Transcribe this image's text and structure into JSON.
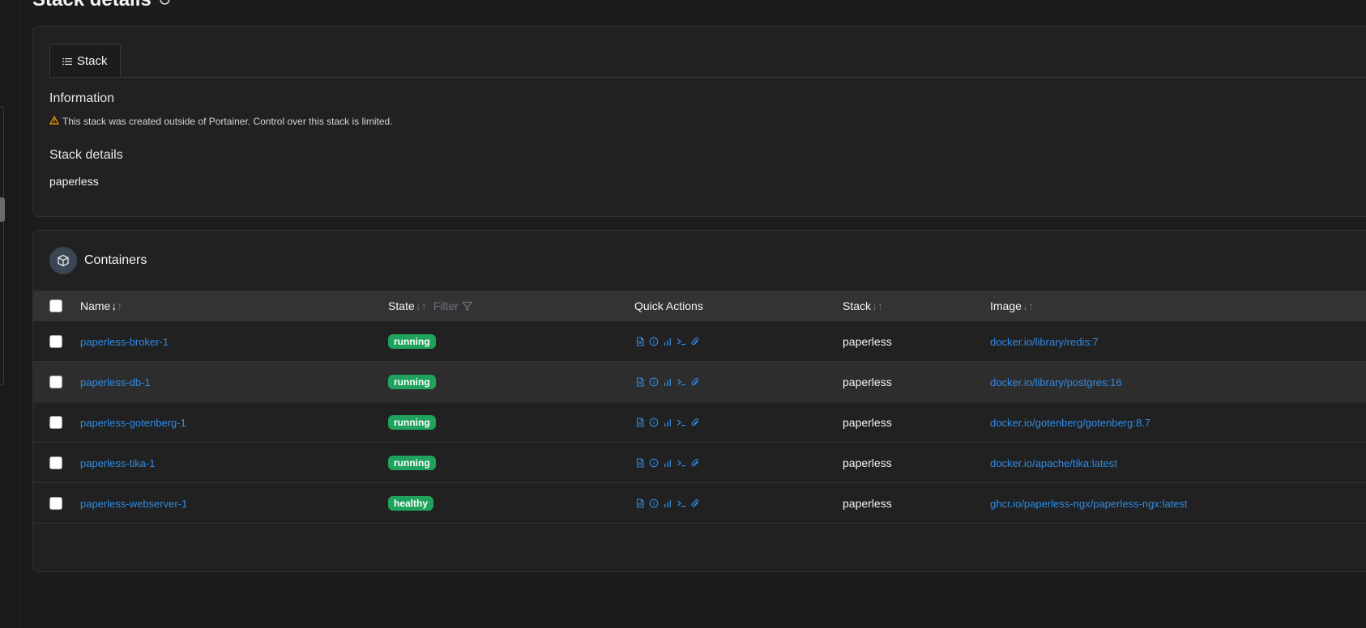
{
  "page": {
    "title": "Stack details"
  },
  "tabs": [
    {
      "label": "Stack"
    }
  ],
  "info": {
    "heading": "Information",
    "warning": "This stack was created outside of Portainer. Control over this stack is limited."
  },
  "details": {
    "heading": "Stack details",
    "name": "paperless"
  },
  "containers": {
    "title": "Containers",
    "columns": {
      "name": "Name",
      "state": "State",
      "filter": "Filter",
      "quick_actions": "Quick Actions",
      "stack": "Stack",
      "image": "Image"
    },
    "rows": [
      {
        "name": "paperless-broker-1",
        "state": "running",
        "stack": "paperless",
        "image": "docker.io/library/redis:7"
      },
      {
        "name": "paperless-db-1",
        "state": "running",
        "stack": "paperless",
        "image": "docker.io/library/postgres:16"
      },
      {
        "name": "paperless-gotenberg-1",
        "state": "running",
        "stack": "paperless",
        "image": "docker.io/gotenberg/gotenberg:8.7"
      },
      {
        "name": "paperless-tika-1",
        "state": "running",
        "stack": "paperless",
        "image": "docker.io/apache/tika:latest"
      },
      {
        "name": "paperless-webserver-1",
        "state": "healthy",
        "stack": "paperless",
        "image": "ghcr.io/paperless-ngx/paperless-ngx:latest"
      }
    ]
  },
  "colors": {
    "accent_link": "#2f8be6",
    "status_green": "#1fa35c",
    "warning": "#f59e0b"
  },
  "icons": {
    "quick_actions": [
      "logs-icon",
      "inspect-icon",
      "stats-icon",
      "console-icon",
      "attach-icon"
    ]
  }
}
